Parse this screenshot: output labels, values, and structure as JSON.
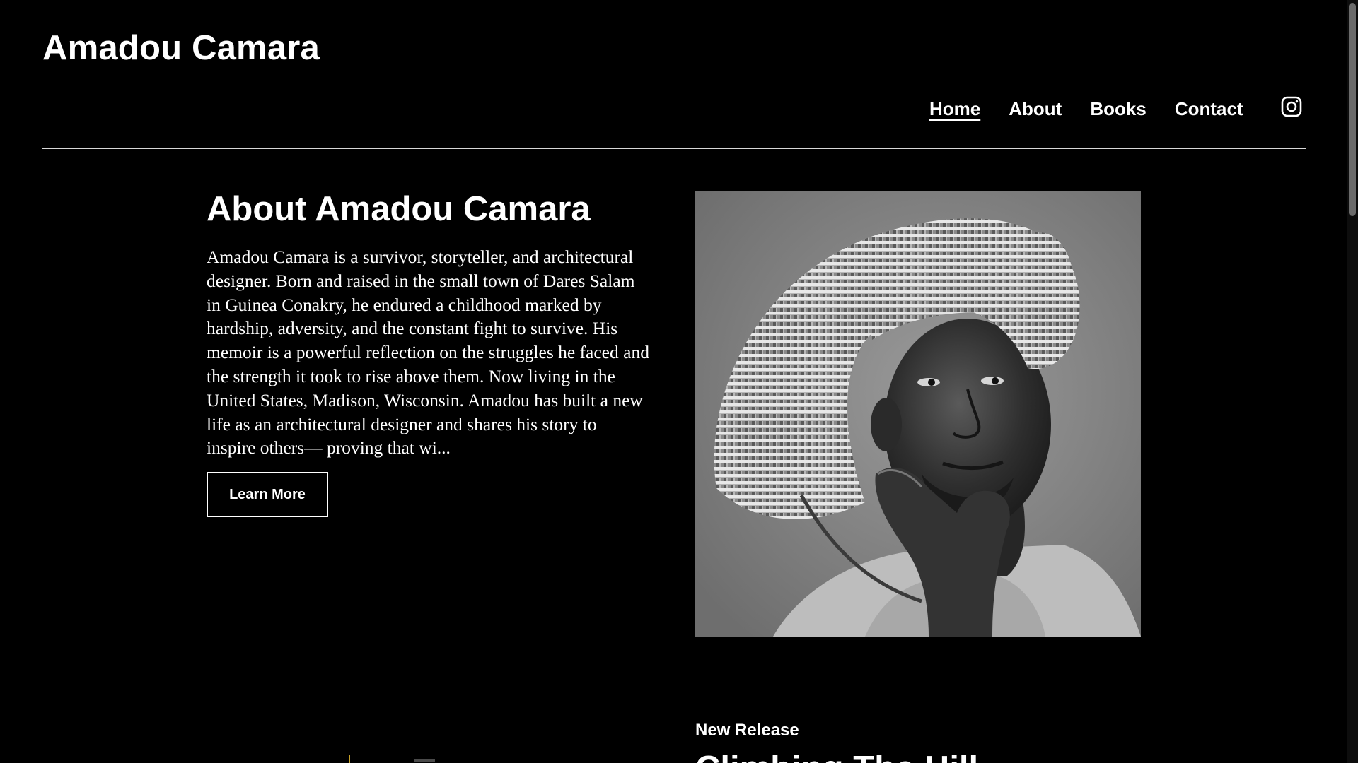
{
  "site": {
    "title": "Amadou Camara"
  },
  "nav": {
    "items": [
      {
        "label": "Home",
        "active": true
      },
      {
        "label": "About",
        "active": false
      },
      {
        "label": "Books",
        "active": false
      },
      {
        "label": "Contact",
        "active": false
      }
    ],
    "social_icon": "instagram-icon"
  },
  "about": {
    "heading": "About Amadou Camara",
    "body": "Amadou Camara is a survivor, storyteller, and architectural designer. Born and raised in the small town of Dares Salam in Guinea Conakry, he endured a childhood marked by hardship, adversity, and the constant fight to survive. His memoir is a powerful reflection on the struggles he faced and the strength it took to rise above them. Now living in the United States, Madison, Wisconsin. Amadou has built a new life as an architectural designer and shares his story to inspire others— proving that wi...",
    "button_label": "Learn More",
    "portrait_alt": "portrait"
  },
  "release": {
    "label": "New Release",
    "title": "Climbing The Hill"
  },
  "colors": {
    "background": "#000000",
    "text": "#ffffff",
    "divider": "#d8d8d8",
    "cover_accent": "#c9a227"
  }
}
